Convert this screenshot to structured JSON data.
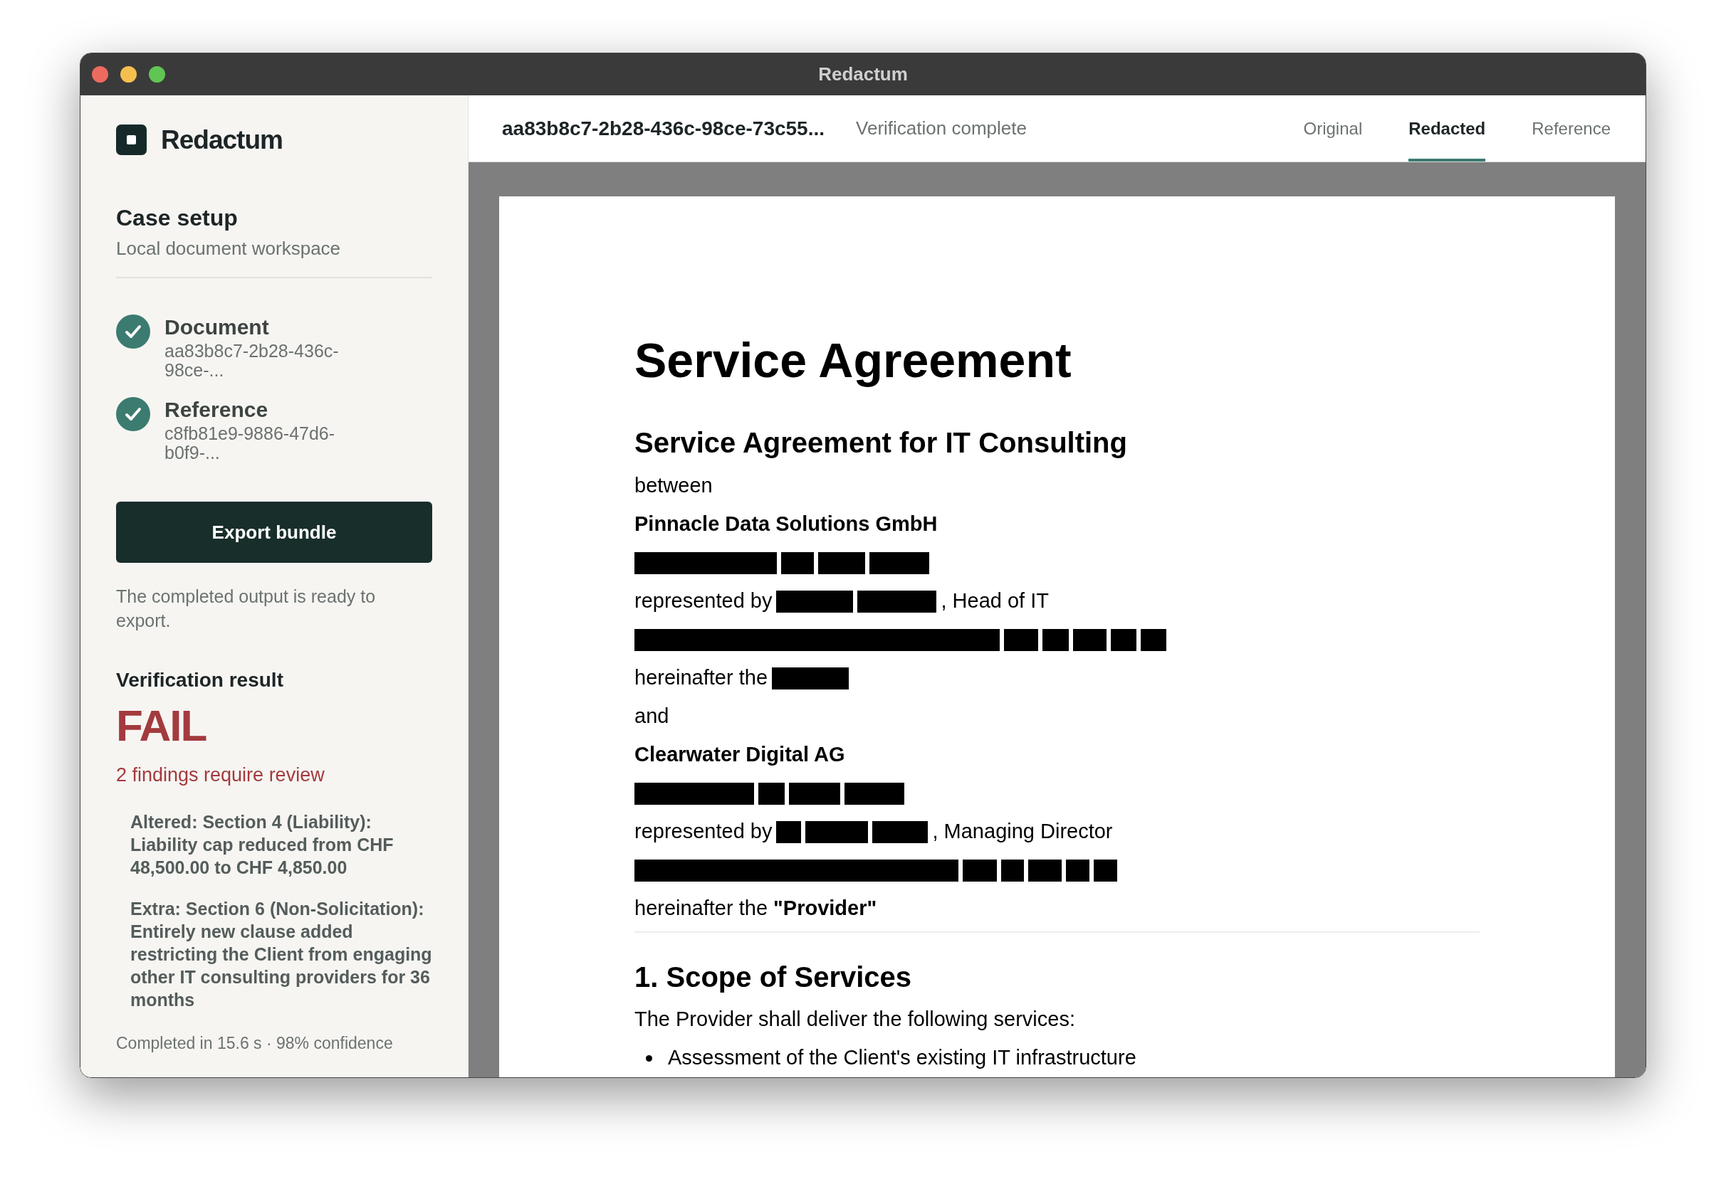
{
  "window": {
    "title": "Redactum"
  },
  "sidebar": {
    "brand": "Redactum",
    "section_title": "Case setup",
    "section_subtitle": "Local document workspace",
    "inputs": [
      {
        "label": "Document",
        "id": "aa83b8c7-2b28-436c-98ce-...",
        "checked": true
      },
      {
        "label": "Reference",
        "id": "c8fb81e9-9886-47d6-b0f9-...",
        "checked": true
      }
    ],
    "export_button": "Export bundle",
    "export_note": "The completed output is ready to export.",
    "verification": {
      "heading": "Verification result",
      "result": "FAIL",
      "summary": "2 findings require review",
      "findings": [
        "Altered: Section 4 (Liability): Liability cap reduced from CHF 48,500.00 to CHF 4,850.00",
        "Extra: Section 6 (Non-Solicitation): Entirely new clause added restricting the Client from engaging other IT consulting providers for 36 months"
      ],
      "footer": "Completed in 15.6 s · 98% confidence"
    }
  },
  "header": {
    "document_id": "aa83b8c7-2b28-436c-98ce-73c55...",
    "status": "Verification complete",
    "tabs": [
      {
        "label": "Original",
        "selected": false
      },
      {
        "label": "Redacted",
        "selected": true
      },
      {
        "label": "Reference",
        "selected": false
      }
    ]
  },
  "document": {
    "blocks": [
      {
        "kind": "title",
        "text": "Service Agreement"
      },
      {
        "kind": "heading",
        "text": "Service Agreement for IT Consulting"
      },
      {
        "kind": "line",
        "parts": [
          {
            "kind": "text",
            "text": "between"
          }
        ]
      },
      {
        "kind": "line",
        "parts": [
          {
            "kind": "strong",
            "text": "Pinnacle Data Solutions GmbH"
          }
        ]
      },
      {
        "kind": "line",
        "parts": [
          {
            "kind": "redaction"
          },
          {
            "kind": "redaction"
          },
          {
            "kind": "redaction"
          },
          {
            "kind": "redaction"
          }
        ]
      },
      {
        "kind": "line",
        "parts": [
          {
            "kind": "text",
            "text": "represented by"
          },
          {
            "kind": "redaction"
          },
          {
            "kind": "redaction"
          },
          {
            "kind": "text",
            "text": ", Head of IT"
          }
        ]
      },
      {
        "kind": "line",
        "parts": [
          {
            "kind": "redaction"
          },
          {
            "kind": "redaction"
          },
          {
            "kind": "redaction"
          },
          {
            "kind": "redaction"
          },
          {
            "kind": "redaction"
          },
          {
            "kind": "redaction"
          }
        ]
      },
      {
        "kind": "line",
        "parts": [
          {
            "kind": "text",
            "text": "hereinafter the"
          },
          {
            "kind": "redaction"
          }
        ]
      },
      {
        "kind": "line",
        "parts": [
          {
            "kind": "text",
            "text": "and"
          }
        ]
      },
      {
        "kind": "line",
        "parts": [
          {
            "kind": "strong",
            "text": "Clearwater Digital AG"
          }
        ]
      },
      {
        "kind": "line",
        "parts": [
          {
            "kind": "redaction"
          },
          {
            "kind": "redaction"
          },
          {
            "kind": "redaction"
          },
          {
            "kind": "redaction"
          }
        ]
      },
      {
        "kind": "line",
        "parts": [
          {
            "kind": "text",
            "text": "represented by"
          },
          {
            "kind": "redaction"
          },
          {
            "kind": "redaction"
          },
          {
            "kind": "redaction"
          },
          {
            "kind": "text",
            "text": ", Managing Director"
          }
        ]
      },
      {
        "kind": "line",
        "parts": [
          {
            "kind": "redaction"
          },
          {
            "kind": "redaction"
          },
          {
            "kind": "redaction"
          },
          {
            "kind": "redaction"
          },
          {
            "kind": "redaction"
          },
          {
            "kind": "redaction"
          }
        ]
      },
      {
        "kind": "line",
        "parts": [
          {
            "kind": "text",
            "text": "hereinafter the **\"Provider\"**"
          }
        ]
      },
      {
        "kind": "rule"
      },
      {
        "kind": "section",
        "text": "1. Scope of Services"
      },
      {
        "kind": "line",
        "parts": [
          {
            "kind": "text",
            "text": "The Provider shall deliver the following services:"
          }
        ]
      },
      {
        "kind": "bullets",
        "items": [
          "Assessment of the Client's existing IT infrastructure"
        ]
      }
    ]
  }
}
